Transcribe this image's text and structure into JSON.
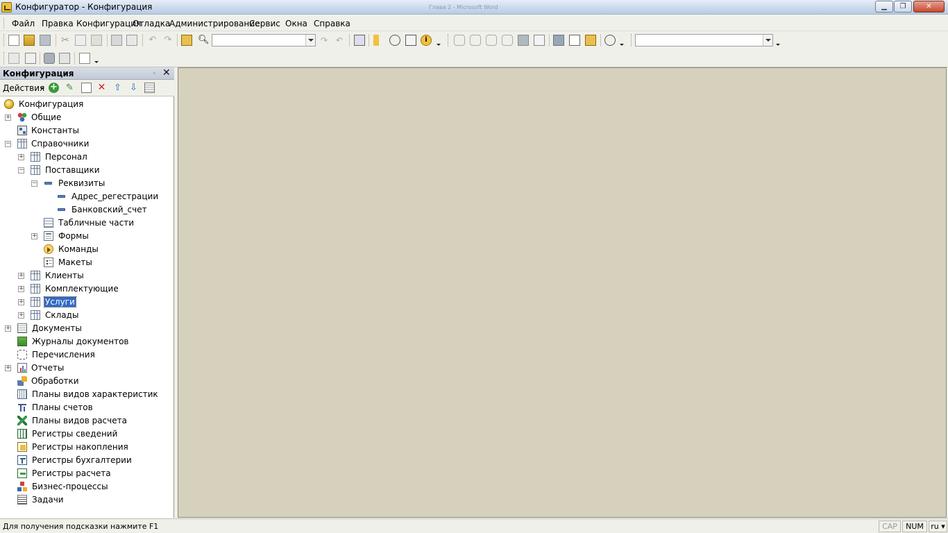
{
  "window": {
    "title": "Конфигуратор - Конфигурация",
    "ghost_title": "Глава 2 - Microsoft Word"
  },
  "menu": [
    "Файл",
    "Правка",
    "Конфигурация",
    "Отладка",
    "Администрирование",
    "Сервис",
    "Окна",
    "Справка"
  ],
  "toolbar": {
    "search_value": "",
    "combo2_value": ""
  },
  "panel": {
    "title": "Конфигурация",
    "pin": "ₕ",
    "actions_label": "Действия"
  },
  "tree": [
    {
      "label": "Конфигурация",
      "icon": "config-ball-icon",
      "expander": ""
    },
    {
      "label": "Общие",
      "icon": "general-icon",
      "expander": "+"
    },
    {
      "label": "Константы",
      "icon": "constants-icon",
      "expander": ""
    },
    {
      "label": "Справочники",
      "icon": "catalog-icon",
      "expander": "−"
    },
    {
      "label": "Персонал",
      "icon": "catalog-icon",
      "expander": "+"
    },
    {
      "label": "Поставщики",
      "icon": "catalog-icon",
      "expander": "−"
    },
    {
      "label": "Реквизиты",
      "icon": "attribute-icon",
      "expander": "−"
    },
    {
      "label": "Адрес_регестрации",
      "icon": "attribute-icon",
      "expander": ""
    },
    {
      "label": "Банковский_счет",
      "icon": "attribute-icon",
      "expander": ""
    },
    {
      "label": "Табличные части",
      "icon": "tabular-section-icon",
      "expander": ""
    },
    {
      "label": "Формы",
      "icon": "form-icon",
      "expander": "+"
    },
    {
      "label": "Команды",
      "icon": "command-icon",
      "expander": ""
    },
    {
      "label": "Макеты",
      "icon": "template-icon",
      "expander": ""
    },
    {
      "label": "Клиенты",
      "icon": "catalog-icon",
      "expander": "+"
    },
    {
      "label": "Комплектующие",
      "icon": "catalog-icon",
      "expander": "+"
    },
    {
      "label": "Услуги",
      "icon": "catalog-icon",
      "expander": "+",
      "selected": true
    },
    {
      "label": "Склады",
      "icon": "catalog-icon",
      "expander": "+"
    },
    {
      "label": "Документы",
      "icon": "document-icon",
      "expander": "+"
    },
    {
      "label": "Журналы документов",
      "icon": "journal-icon",
      "expander": ""
    },
    {
      "label": "Перечисления",
      "icon": "enum-icon",
      "expander": ""
    },
    {
      "label": "Отчеты",
      "icon": "report-icon",
      "expander": "+"
    },
    {
      "label": "Обработки",
      "icon": "data-processor-icon",
      "expander": ""
    },
    {
      "label": "Планы видов характеристик",
      "icon": "chart-of-characteristic-types-icon",
      "expander": ""
    },
    {
      "label": "Планы счетов",
      "icon": "chart-of-accounts-icon",
      "expander": ""
    },
    {
      "label": "Планы видов расчета",
      "icon": "chart-of-calculation-types-icon",
      "expander": ""
    },
    {
      "label": "Регистры сведений",
      "icon": "information-register-icon",
      "expander": ""
    },
    {
      "label": "Регистры накопления",
      "icon": "accumulation-register-icon",
      "expander": ""
    },
    {
      "label": "Регистры бухгалтерии",
      "icon": "accounting-register-icon",
      "expander": ""
    },
    {
      "label": "Регистры расчета",
      "icon": "calculation-register-icon",
      "expander": ""
    },
    {
      "label": "Бизнес-процессы",
      "icon": "business-process-icon",
      "expander": ""
    },
    {
      "label": "Задачи",
      "icon": "task-icon",
      "expander": ""
    }
  ],
  "statusbar": {
    "hint": "Для получения подсказки нажмите F1",
    "cap": "CAP",
    "num": "NUM",
    "lang": "ru ▾"
  }
}
